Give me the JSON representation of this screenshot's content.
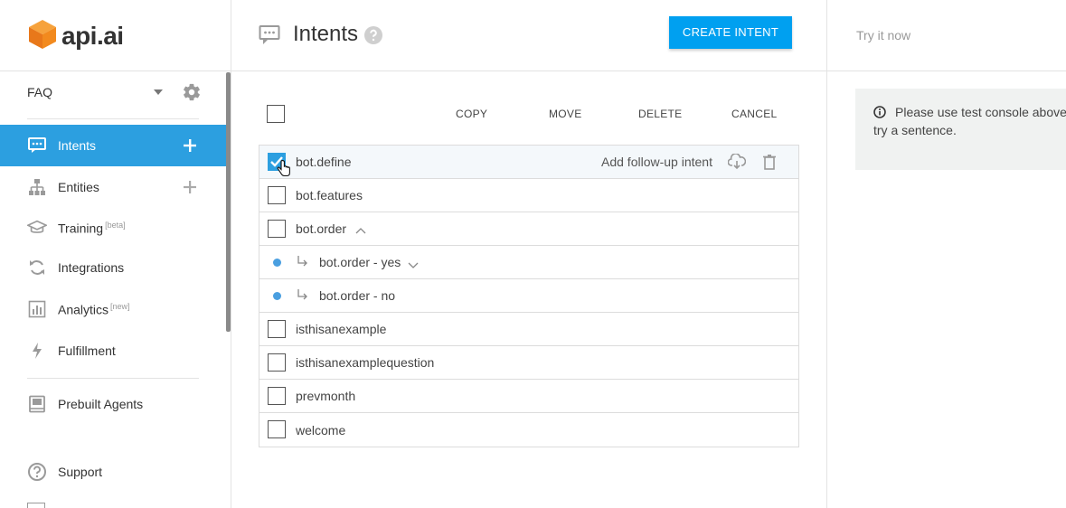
{
  "sidebar": {
    "logo_text": "api.ai",
    "agent": {
      "name": "FAQ"
    },
    "nav": [
      {
        "label": "Intents",
        "badge": "",
        "active": true
      },
      {
        "label": "Entities",
        "badge": ""
      },
      {
        "label": "Training",
        "badge": "[beta]"
      },
      {
        "label": "Integrations",
        "badge": ""
      },
      {
        "label": "Analytics",
        "badge": "[new]"
      },
      {
        "label": "Fulfillment",
        "badge": ""
      },
      {
        "label": "Prebuilt Agents",
        "badge": ""
      },
      {
        "label": "Support",
        "badge": ""
      }
    ]
  },
  "header": {
    "title": "Intents",
    "create_button": "CREATE INTENT"
  },
  "toolbar": {
    "copy": "COPY",
    "move": "MOVE",
    "delete": "DELETE",
    "cancel": "CANCEL"
  },
  "intents": [
    {
      "name": "bot.define",
      "checked": true,
      "followup": "Add follow-up intent"
    },
    {
      "name": "bot.features"
    },
    {
      "name": "bot.order"
    },
    {
      "name": "bot.order - yes",
      "child": true
    },
    {
      "name": "bot.order - no",
      "child": true
    },
    {
      "name": "isthisanexample"
    },
    {
      "name": "isthisanexamplequestion"
    },
    {
      "name": "prevmonth"
    },
    {
      "name": "welcome"
    }
  ],
  "right_panel": {
    "try_placeholder": "Try it now",
    "info_line1": "Please use test console above t",
    "info_line2": "try a sentence."
  },
  "colors": {
    "accent": "#2c9fe0",
    "create_button": "#00a0f0",
    "logo_orange": "#f28a1e"
  }
}
